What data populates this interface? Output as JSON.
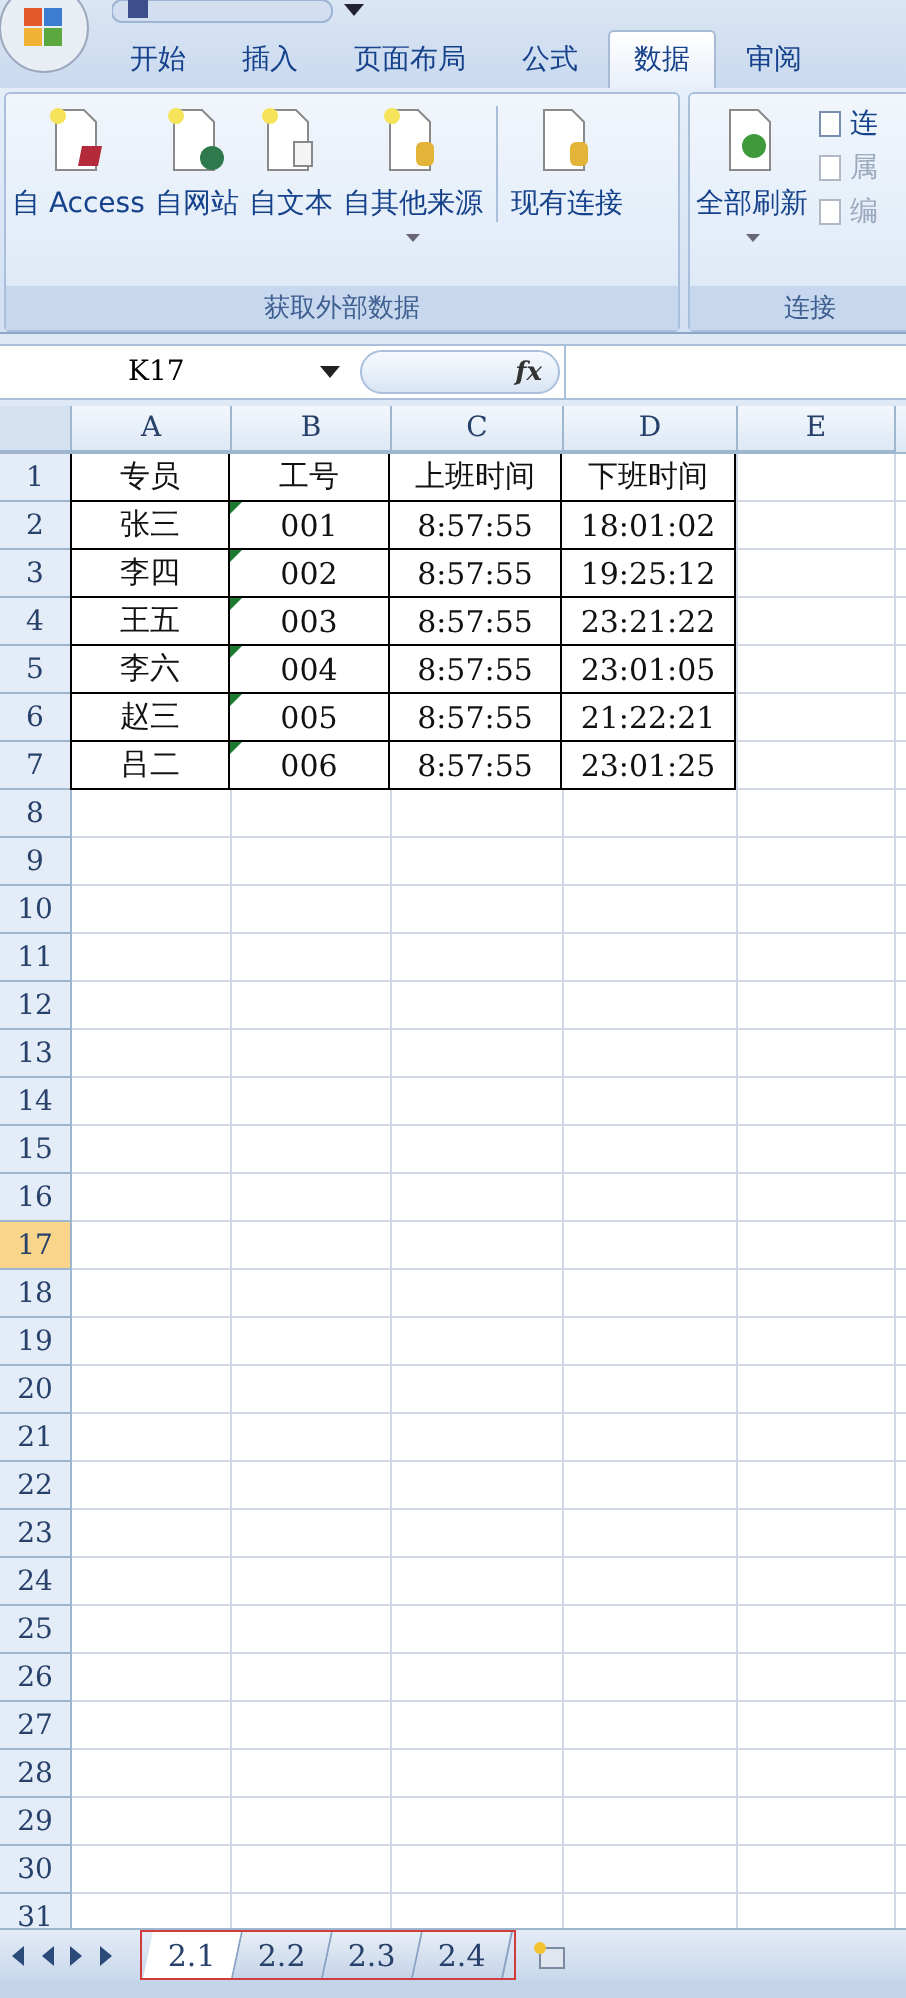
{
  "ribbon": {
    "tabs": [
      {
        "label": "开始",
        "selected": false
      },
      {
        "label": "插入",
        "selected": false
      },
      {
        "label": "页面布局",
        "selected": false
      },
      {
        "label": "公式",
        "selected": false
      },
      {
        "label": "数据",
        "selected": true
      },
      {
        "label": "审阅",
        "selected": false
      }
    ],
    "groups": [
      {
        "label": "获取外部数据",
        "buttons": [
          {
            "label": "自 Access",
            "dropdown": false,
            "separator_before": false
          },
          {
            "label": "自网站",
            "dropdown": false,
            "separator_before": false
          },
          {
            "label": "自文本",
            "dropdown": false,
            "separator_before": false
          },
          {
            "label": "自其他来源",
            "dropdown": true,
            "separator_before": false
          },
          {
            "label": "现有连接",
            "dropdown": false,
            "separator_before": true
          }
        ]
      },
      {
        "label": "连接",
        "buttons": [
          {
            "label": "全部刷新",
            "dropdown": true,
            "separator_before": false
          }
        ],
        "small_buttons": [
          {
            "label": "连",
            "disabled": false
          },
          {
            "label": "属",
            "disabled": true
          },
          {
            "label": "编",
            "disabled": true
          }
        ]
      }
    ]
  },
  "formula_bar": {
    "name_box": "K17",
    "function_label": "fx"
  },
  "sheet": {
    "columns": [
      {
        "label": "A",
        "selected": false
      },
      {
        "label": "B",
        "selected": false
      },
      {
        "label": "C",
        "selected": false
      },
      {
        "label": "D",
        "selected": false
      },
      {
        "label": "E",
        "selected": false
      }
    ],
    "rows": [
      {
        "header": "1",
        "selected": false,
        "flag": false,
        "cells": [
          "专员",
          "工号",
          "上班时间",
          "下班时间"
        ]
      },
      {
        "header": "2",
        "selected": false,
        "flag": true,
        "cells": [
          "张三",
          "001",
          "8:57:55",
          "18:01:02"
        ]
      },
      {
        "header": "3",
        "selected": false,
        "flag": true,
        "cells": [
          "李四",
          "002",
          "8:57:55",
          "19:25:12"
        ]
      },
      {
        "header": "4",
        "selected": false,
        "flag": true,
        "cells": [
          "王五",
          "003",
          "8:57:55",
          "23:21:22"
        ]
      },
      {
        "header": "5",
        "selected": false,
        "flag": true,
        "cells": [
          "李六",
          "004",
          "8:57:55",
          "23:01:05"
        ]
      },
      {
        "header": "6",
        "selected": false,
        "flag": true,
        "cells": [
          "赵三",
          "005",
          "8:57:55",
          "21:22:21"
        ]
      },
      {
        "header": "7",
        "selected": false,
        "flag": true,
        "cells": [
          "吕二",
          "006",
          "8:57:55",
          "23:01:25"
        ]
      },
      {
        "header": "8",
        "selected": false,
        "flag": false,
        "cells": []
      },
      {
        "header": "9",
        "selected": false,
        "flag": false,
        "cells": []
      },
      {
        "header": "10",
        "selected": false,
        "flag": false,
        "cells": []
      },
      {
        "header": "11",
        "selected": false,
        "flag": false,
        "cells": []
      },
      {
        "header": "12",
        "selected": false,
        "flag": false,
        "cells": []
      },
      {
        "header": "13",
        "selected": false,
        "flag": false,
        "cells": []
      },
      {
        "header": "14",
        "selected": false,
        "flag": false,
        "cells": []
      },
      {
        "header": "15",
        "selected": false,
        "flag": false,
        "cells": []
      },
      {
        "header": "16",
        "selected": false,
        "flag": false,
        "cells": []
      },
      {
        "header": "17",
        "selected": true,
        "flag": false,
        "cells": []
      },
      {
        "header": "18",
        "selected": false,
        "flag": false,
        "cells": []
      },
      {
        "header": "19",
        "selected": false,
        "flag": false,
        "cells": []
      },
      {
        "header": "20",
        "selected": false,
        "flag": false,
        "cells": []
      },
      {
        "header": "21",
        "selected": false,
        "flag": false,
        "cells": []
      },
      {
        "header": "22",
        "selected": false,
        "flag": false,
        "cells": []
      },
      {
        "header": "23",
        "selected": false,
        "flag": false,
        "cells": []
      },
      {
        "header": "24",
        "selected": false,
        "flag": false,
        "cells": []
      },
      {
        "header": "25",
        "selected": false,
        "flag": false,
        "cells": []
      },
      {
        "header": "26",
        "selected": false,
        "flag": false,
        "cells": []
      },
      {
        "header": "27",
        "selected": false,
        "flag": false,
        "cells": []
      },
      {
        "header": "28",
        "selected": false,
        "flag": false,
        "cells": []
      },
      {
        "header": "29",
        "selected": false,
        "flag": false,
        "cells": []
      },
      {
        "header": "30",
        "selected": false,
        "flag": false,
        "cells": []
      },
      {
        "header": "31",
        "selected": false,
        "flag": false,
        "cells": []
      }
    ]
  },
  "sheet_tabs": {
    "outlined": true,
    "tabs": [
      {
        "label": "2.1",
        "selected": true
      },
      {
        "label": "2.2",
        "selected": false
      },
      {
        "label": "2.3",
        "selected": false
      },
      {
        "label": "2.4",
        "selected": false
      }
    ]
  }
}
